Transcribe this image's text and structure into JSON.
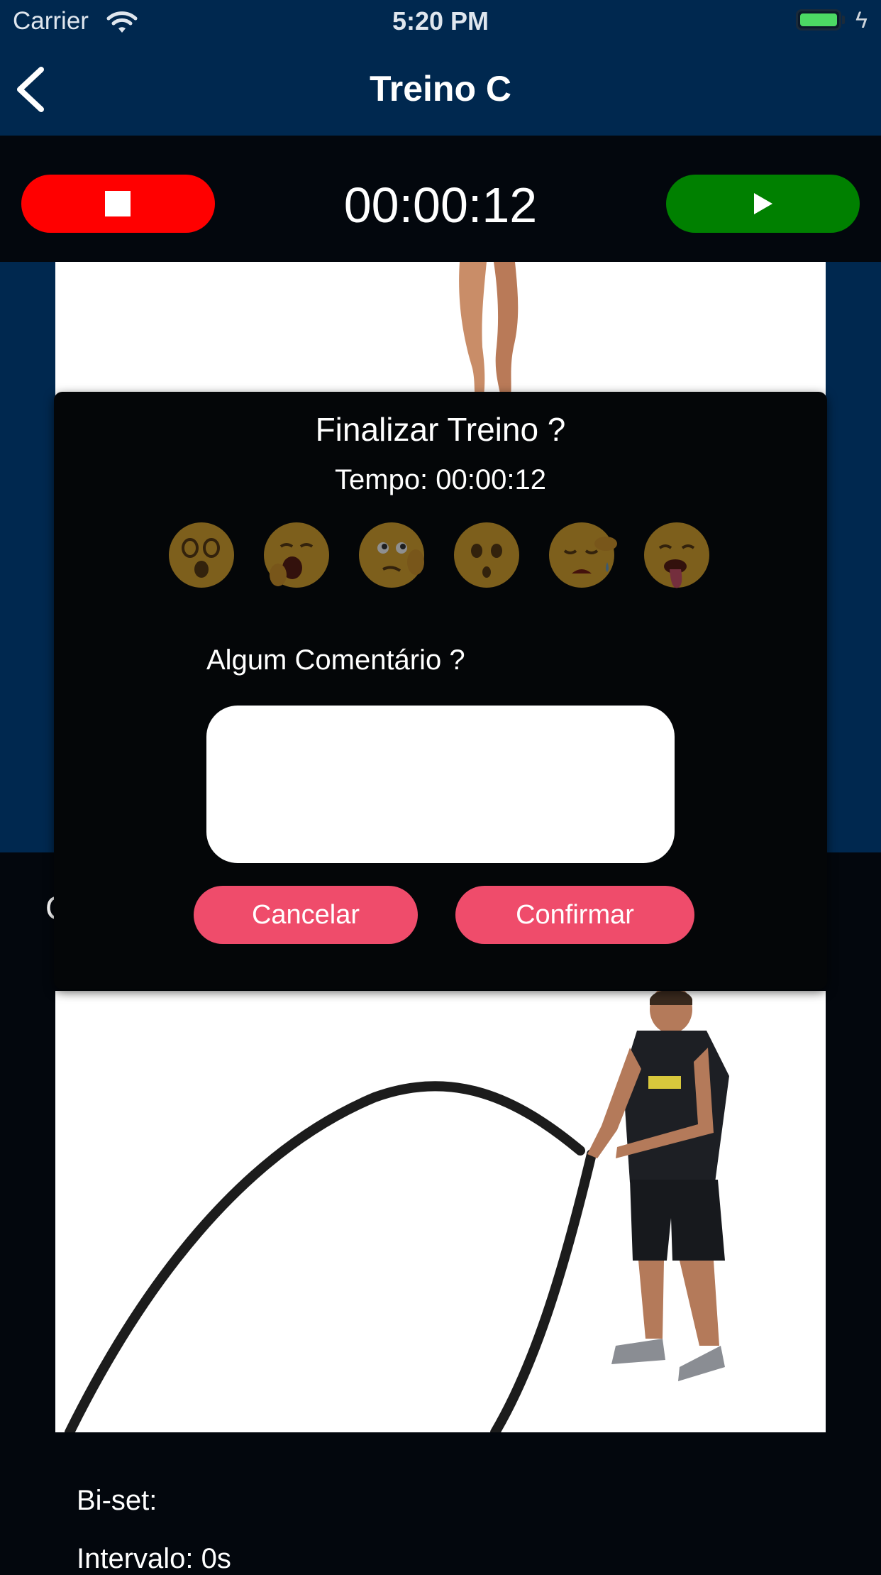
{
  "status_bar": {
    "carrier": "Carrier",
    "time": "5:20 PM"
  },
  "nav": {
    "title": "Treino C"
  },
  "timer": {
    "elapsed": "00:00:12"
  },
  "card": {
    "name_partial": "C"
  },
  "exercise": {
    "biset": "Bi-set:",
    "interval": "Intervalo: 0s"
  },
  "modal": {
    "title": "Finalizar Treino ?",
    "time_label": "Tempo: 00:00:12",
    "question": "Algum Comentário ?",
    "comment_value": "",
    "cancel_label": "Cancelar",
    "confirm_label": "Confirmar",
    "emojis": [
      "dizzy-emoji",
      "yawning-emoji",
      "thinking-emoji",
      "sad-emoji",
      "crying-emoji",
      "exhausted-emoji"
    ]
  },
  "colors": {
    "nav_bg": "#00284f",
    "dark_bg": "#03070d",
    "stop": "#ff0000",
    "play": "#008000",
    "modal_button": "#ef4c6b",
    "emoji": "#e0a82e"
  }
}
